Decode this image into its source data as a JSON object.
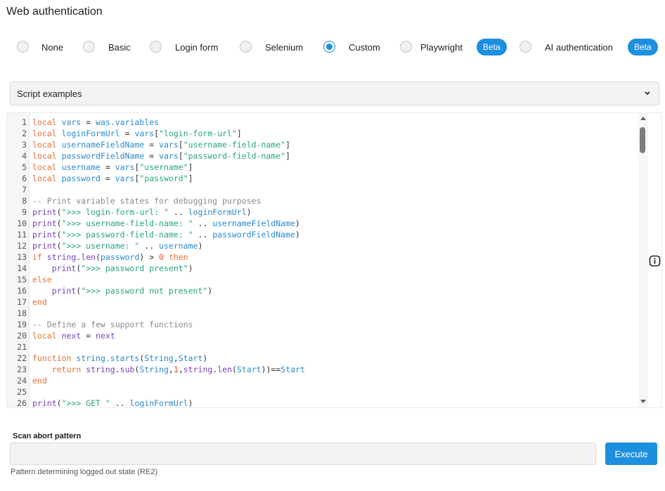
{
  "page": {
    "title": "Web authentication"
  },
  "auth_methods": [
    {
      "label": "None",
      "selected": false
    },
    {
      "label": "Basic",
      "selected": false
    },
    {
      "label": "Login form",
      "selected": false
    },
    {
      "label": "Selenium",
      "selected": false
    },
    {
      "label": "Custom",
      "selected": true
    },
    {
      "label": "Playwright",
      "selected": false,
      "badge": "Beta"
    },
    {
      "label": "AI authentication",
      "selected": false,
      "badge": "Beta"
    }
  ],
  "script_examples": {
    "selected": "Script examples",
    "icon": "chevron-down-icon"
  },
  "editor": {
    "lines": [
      [
        [
          "k",
          "local"
        ],
        [
          "p",
          " "
        ],
        [
          "v",
          "vars"
        ],
        [
          "p",
          " = "
        ],
        [
          "v",
          "was.variables"
        ]
      ],
      [
        [
          "k",
          "local"
        ],
        [
          "p",
          " "
        ],
        [
          "v",
          "loginFormUrl"
        ],
        [
          "p",
          " = "
        ],
        [
          "v",
          "vars"
        ],
        [
          "p",
          "["
        ],
        [
          "s",
          "\"login-form-url\""
        ],
        [
          "p",
          "]"
        ]
      ],
      [
        [
          "k",
          "local"
        ],
        [
          "p",
          " "
        ],
        [
          "v",
          "usernameFieldName"
        ],
        [
          "p",
          " = "
        ],
        [
          "v",
          "vars"
        ],
        [
          "p",
          "["
        ],
        [
          "s",
          "\"username-field-name\""
        ],
        [
          "p",
          "]"
        ]
      ],
      [
        [
          "k",
          "local"
        ],
        [
          "p",
          " "
        ],
        [
          "v",
          "passwordFieldName"
        ],
        [
          "p",
          " = "
        ],
        [
          "v",
          "vars"
        ],
        [
          "p",
          "["
        ],
        [
          "s",
          "\"password-field-name\""
        ],
        [
          "p",
          "]"
        ]
      ],
      [
        [
          "k",
          "local"
        ],
        [
          "p",
          " "
        ],
        [
          "v",
          "username"
        ],
        [
          "p",
          " = "
        ],
        [
          "v",
          "vars"
        ],
        [
          "p",
          "["
        ],
        [
          "s",
          "\"username\""
        ],
        [
          "p",
          "]"
        ]
      ],
      [
        [
          "k",
          "local"
        ],
        [
          "p",
          " "
        ],
        [
          "v",
          "password"
        ],
        [
          "p",
          " = "
        ],
        [
          "v",
          "vars"
        ],
        [
          "p",
          "["
        ],
        [
          "s",
          "\"password\""
        ],
        [
          "p",
          "]"
        ]
      ],
      [],
      [
        [
          "c",
          "-- Print variable states for debugging purposes"
        ]
      ],
      [
        [
          "f",
          "print"
        ],
        [
          "p",
          "("
        ],
        [
          "s",
          "\">>> login-form-url: \""
        ],
        [
          "p",
          " .. "
        ],
        [
          "v",
          "loginFormUrl"
        ],
        [
          "p",
          ")"
        ]
      ],
      [
        [
          "f",
          "print"
        ],
        [
          "p",
          "("
        ],
        [
          "s",
          "\">>> username-field-name: \""
        ],
        [
          "p",
          " .. "
        ],
        [
          "v",
          "usernameFieldName"
        ],
        [
          "p",
          ")"
        ]
      ],
      [
        [
          "f",
          "print"
        ],
        [
          "p",
          "("
        ],
        [
          "s",
          "\">>> password-field-name: \""
        ],
        [
          "p",
          " .. "
        ],
        [
          "v",
          "passwordFieldName"
        ],
        [
          "p",
          ")"
        ]
      ],
      [
        [
          "f",
          "print"
        ],
        [
          "p",
          "("
        ],
        [
          "s",
          "\">>> username: \""
        ],
        [
          "p",
          " .. "
        ],
        [
          "v",
          "username"
        ],
        [
          "p",
          ")"
        ]
      ],
      [
        [
          "k",
          "if"
        ],
        [
          "p",
          " "
        ],
        [
          "f",
          "string"
        ],
        [
          "p",
          "."
        ],
        [
          "f",
          "len"
        ],
        [
          "p",
          "("
        ],
        [
          "v",
          "password"
        ],
        [
          "p",
          ") > "
        ],
        [
          "n",
          "0"
        ],
        [
          "p",
          " "
        ],
        [
          "k",
          "then"
        ]
      ],
      [
        [
          "p",
          "    "
        ],
        [
          "f",
          "print"
        ],
        [
          "p",
          "("
        ],
        [
          "s",
          "\">>> password present\""
        ],
        [
          "p",
          ")"
        ]
      ],
      [
        [
          "k",
          "else"
        ]
      ],
      [
        [
          "p",
          "    "
        ],
        [
          "f",
          "print"
        ],
        [
          "p",
          "("
        ],
        [
          "s",
          "\">>> password not present\""
        ],
        [
          "p",
          ")"
        ]
      ],
      [
        [
          "k",
          "end"
        ]
      ],
      [],
      [
        [
          "c",
          "-- Define a few support functions"
        ]
      ],
      [
        [
          "k",
          "local"
        ],
        [
          "p",
          " "
        ],
        [
          "f",
          "next"
        ],
        [
          "p",
          " = "
        ],
        [
          "f",
          "next"
        ]
      ],
      [],
      [
        [
          "k",
          "function"
        ],
        [
          "p",
          " "
        ],
        [
          "v",
          "string.starts"
        ],
        [
          "p",
          "("
        ],
        [
          "v",
          "String"
        ],
        [
          "p",
          ","
        ],
        [
          "v",
          "Start"
        ],
        [
          "p",
          ")"
        ]
      ],
      [
        [
          "p",
          "    "
        ],
        [
          "k",
          "return"
        ],
        [
          "p",
          " "
        ],
        [
          "f",
          "string"
        ],
        [
          "p",
          "."
        ],
        [
          "f",
          "sub"
        ],
        [
          "p",
          "("
        ],
        [
          "v",
          "String"
        ],
        [
          "p",
          ","
        ],
        [
          "n",
          "1"
        ],
        [
          "p",
          ","
        ],
        [
          "f",
          "string"
        ],
        [
          "p",
          "."
        ],
        [
          "f",
          "len"
        ],
        [
          "p",
          "("
        ],
        [
          "v",
          "Start"
        ],
        [
          "p",
          "))=="
        ],
        [
          "v",
          "Start"
        ]
      ],
      [
        [
          "k",
          "end"
        ]
      ],
      [],
      [
        [
          "f",
          "print"
        ],
        [
          "p",
          "("
        ],
        [
          "s",
          "\">>> GET \""
        ],
        [
          "p",
          " .. "
        ],
        [
          "v",
          "loginFormUrl"
        ],
        [
          "p",
          ")"
        ]
      ]
    ]
  },
  "scan_abort": {
    "label": "Scan abort pattern",
    "value": "",
    "placeholder": "",
    "hint": "Pattern determining logged out state (RE2)"
  },
  "execute_button": {
    "label": "Execute"
  },
  "colors": {
    "accent": "#1d8fe0",
    "keyword": "#e8713a",
    "variable": "#2a8ad1",
    "string": "#26a776",
    "function": "#7c3fc2",
    "comment": "#8b8b8b",
    "number": "#e84a3a"
  }
}
